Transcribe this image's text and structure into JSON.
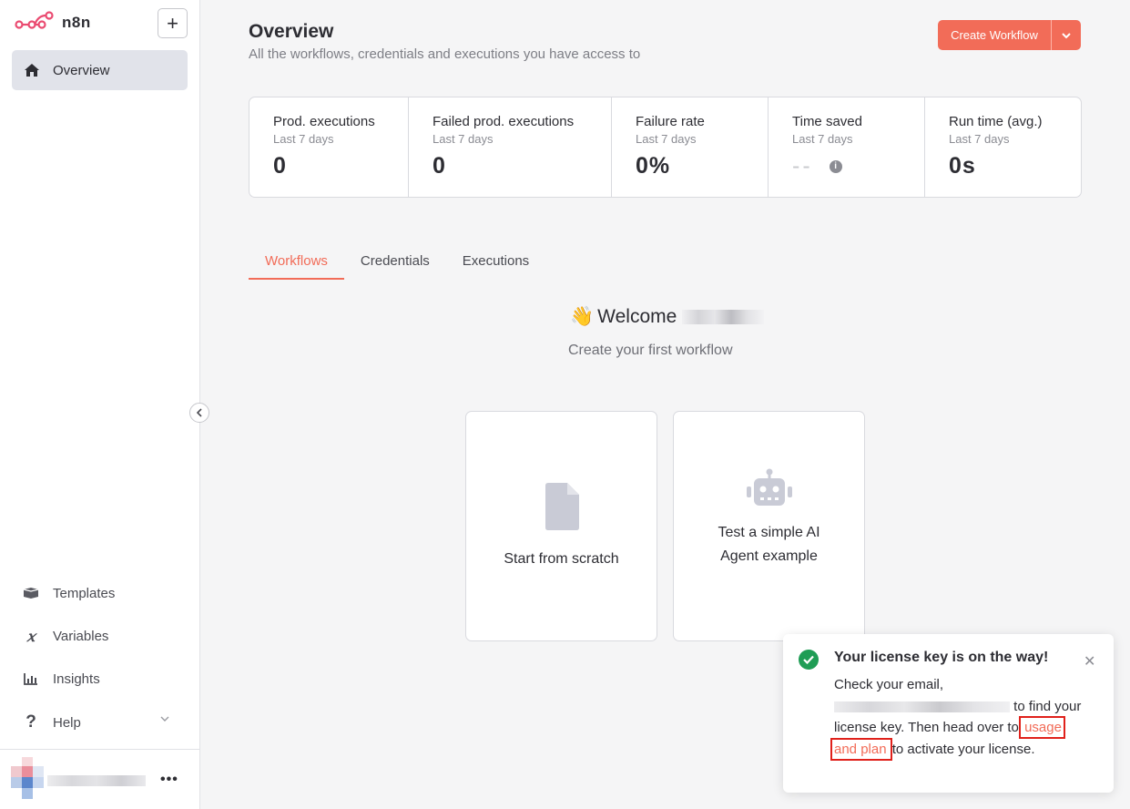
{
  "app": {
    "name": "n8n"
  },
  "sidebar": {
    "overview_label": "Overview",
    "bottom_items": [
      {
        "label": "Templates",
        "icon": "box-icon"
      },
      {
        "label": "Variables",
        "icon": "variable-x-icon"
      },
      {
        "label": "Insights",
        "icon": "bar-chart-icon"
      },
      {
        "label": "Help",
        "icon": "question-icon"
      }
    ]
  },
  "header": {
    "title": "Overview",
    "subtitle": "All the workflows, credentials and executions you have access to",
    "create_label": "Create Workflow"
  },
  "stats": [
    {
      "label": "Prod. executions",
      "period": "Last 7 days",
      "value": "0"
    },
    {
      "label": "Failed prod. executions",
      "period": "Last 7 days",
      "value": "0"
    },
    {
      "label": "Failure rate",
      "period": "Last 7 days",
      "value": "0%"
    },
    {
      "label": "Time saved",
      "period": "Last 7 days",
      "value": "--"
    },
    {
      "label": "Run time (avg.)",
      "period": "Last 7 days",
      "value": "0s"
    }
  ],
  "tabs": [
    {
      "label": "Workflows",
      "active": true
    },
    {
      "label": "Credentials",
      "active": false
    },
    {
      "label": "Executions",
      "active": false
    }
  ],
  "welcome": {
    "emoji": "👋",
    "greeting": "Welcome",
    "subtitle": "Create your first workflow"
  },
  "cards": [
    {
      "label": "Start from scratch",
      "icon": "file-icon"
    },
    {
      "label": "Test a simple AI Agent example",
      "icon": "robot-icon"
    }
  ],
  "toast": {
    "title": "Your license key is on the way!",
    "text_1": "Check your email,",
    "text_2": "to find your license key. Then head over to",
    "link": "usage and plan",
    "text_3": "to activate your license."
  },
  "colors": {
    "accent": "#f26c58",
    "success": "#1f9d55"
  }
}
